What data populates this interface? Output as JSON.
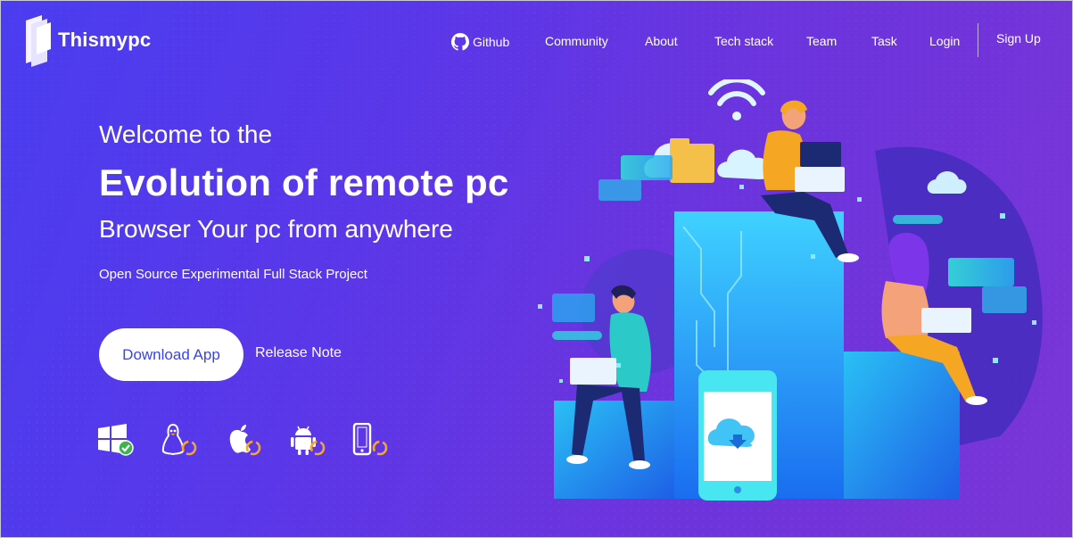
{
  "brand": {
    "name": "Thismypc"
  },
  "nav": {
    "github": "Github",
    "community": "Community",
    "about": "About",
    "tech_stack": "Tech stack",
    "team": "Team",
    "task": "Task",
    "login": "Login",
    "signup": "Sign Up"
  },
  "hero": {
    "welcome": "Welcome to the",
    "headline": "Evolution of remote pc",
    "subhead": "Browser Your pc from anywhere",
    "tagline": "Open Source Experimental Full Stack Project",
    "download_label": "Download App",
    "release_label": "Release Note"
  },
  "platforms": [
    {
      "icon": "windows-icon",
      "status": "available"
    },
    {
      "icon": "linux-icon",
      "status": "in-progress"
    },
    {
      "icon": "apple-icon",
      "status": "in-progress"
    },
    {
      "icon": "android-icon",
      "status": "in-progress"
    },
    {
      "icon": "mobile-icon",
      "status": "in-progress"
    }
  ],
  "colors": {
    "bg_start": "#4a3df0",
    "bg_end": "#7a35d6",
    "button_text": "#3b44e0",
    "check_green": "#3bb54a",
    "progress_orange": "#f5a623"
  }
}
